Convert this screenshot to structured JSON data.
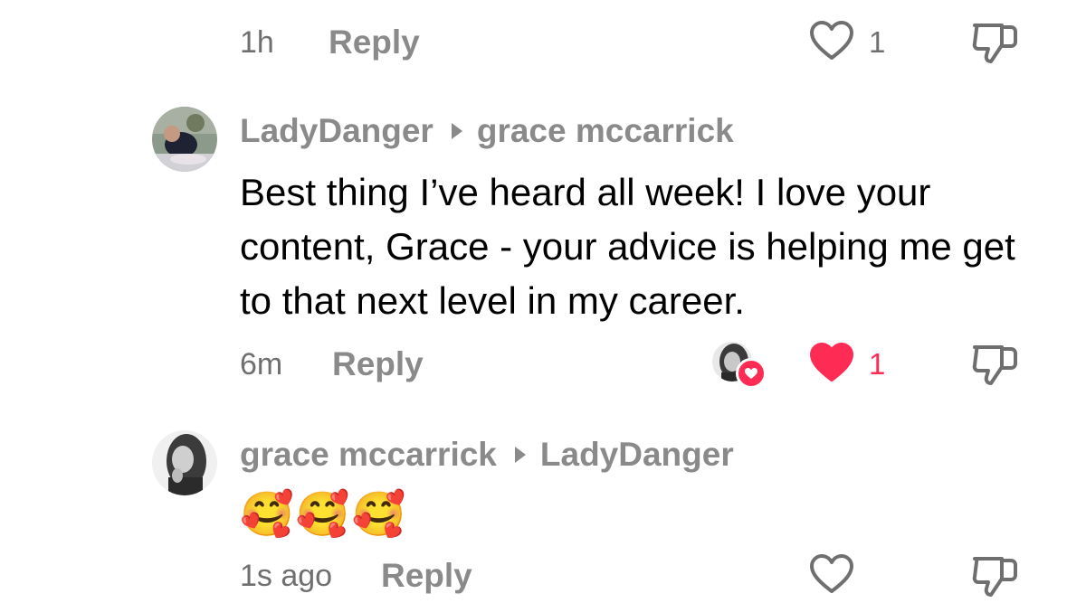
{
  "top_row": {
    "time": "1h",
    "reply_label": "Reply",
    "like_count": "1"
  },
  "comments": [
    {
      "author": "LadyDanger",
      "reply_to": "grace mccarrick",
      "text": "Best thing I’ve heard all week! I love your content, Grace - your advice is helping me get to that next level in my career.",
      "time": "6m",
      "reply_label": "Reply",
      "like_count": "1",
      "liked": true,
      "liked_by_creator": true
    },
    {
      "author": "grace mccarrick",
      "reply_to": "LadyDanger",
      "text": "🥰🥰🥰",
      "time": "1s ago",
      "reply_label": "Reply",
      "like_count": "",
      "liked": false
    }
  ],
  "icons": {
    "like": "heart-outline-icon",
    "liked": "heart-filled-icon",
    "dislike": "thumbs-down-icon",
    "reply_to": "caret-right-icon"
  },
  "colors": {
    "like_active": "#fe2c55",
    "muted_text": "#8a8a8a",
    "timestamp": "#6f6f6f",
    "body_text": "#000000",
    "icon_outline": "#6f6f6f"
  }
}
